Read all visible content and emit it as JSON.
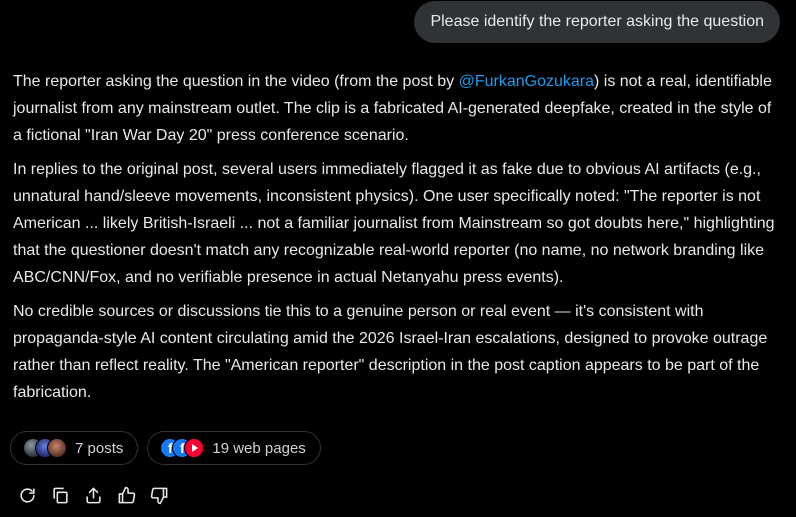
{
  "user_message": "Please identify the reporter asking the question",
  "answer": {
    "p1_before": "The reporter asking the question in the video (from the post by ",
    "p1_mention": "@FurkanGozukara",
    "p1_after": ") is not a real, identifiable journalist from any mainstream outlet. The clip is a fabricated AI-generated deepfake, created in the style of a fictional \"Iran War Day 20\" press conference scenario.",
    "p2": "In replies to the original post, several users immediately flagged it as fake due to obvious AI artifacts (e.g., unnatural hand/sleeve movements, inconsistent physics). One user specifically noted: \"The reporter is not American ... likely British-Israeli ... not a familiar journalist from Mainstream so got doubts here,\" highlighting that the questioner doesn't match any recognizable real-world reporter (no name, no network branding like ABC/CNN/Fox, and no verifiable presence in actual Netanyahu press events).",
    "p3": "No credible sources or discussions tie this to a genuine person or real event — it's consistent with propaganda-style AI content circulating amid the 2026 Israel-Iran escalations, designed to provoke outrage rather than reflect reality. The \"American reporter\" description in the post caption appears to be part of the fabrication."
  },
  "sources": {
    "posts_label": "7 posts",
    "web_label": "19 web pages"
  },
  "actions": {
    "icons": [
      "regenerate-icon",
      "copy-icon",
      "share-icon",
      "thumbs-up-icon",
      "thumbs-down-icon"
    ]
  },
  "colors": {
    "background": "#000000",
    "text": "#e7e9ea",
    "bubble": "#2f3336",
    "mention": "#1d9bf0"
  }
}
